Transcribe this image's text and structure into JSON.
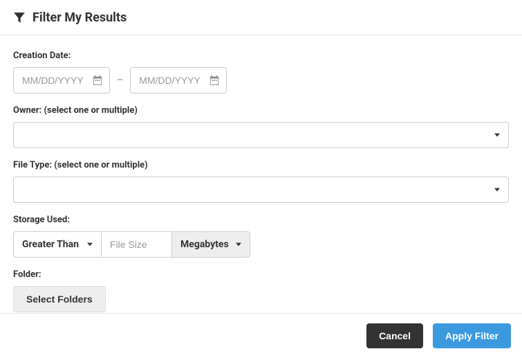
{
  "header": {
    "title": "Filter My Results"
  },
  "creationDate": {
    "label": "Creation Date:",
    "fromPlaceholder": "MM/DD/YYYY",
    "toPlaceholder": "MM/DD/YYYY",
    "dash": "–"
  },
  "owner": {
    "label": "Owner: (select one or multiple)",
    "value": ""
  },
  "fileType": {
    "label": "File Type: (select one or multiple)",
    "value": ""
  },
  "storage": {
    "label": "Storage Used:",
    "operator": "Greater Than",
    "sizePlaceholder": "File Size",
    "unit": "Megabytes"
  },
  "folder": {
    "label": "Folder:",
    "buttonLabel": "Select Folders"
  },
  "footer": {
    "cancel": "Cancel",
    "apply": "Apply Filter"
  }
}
